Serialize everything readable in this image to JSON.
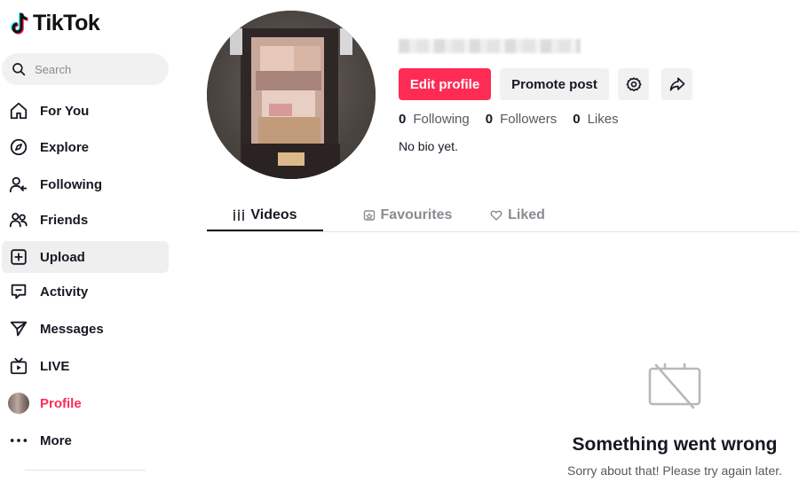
{
  "app": {
    "name": "TikTok"
  },
  "search": {
    "placeholder": "Search"
  },
  "nav": [
    {
      "key": "for-you",
      "label": "For You",
      "icon": "home-icon"
    },
    {
      "key": "explore",
      "label": "Explore",
      "icon": "compass-icon"
    },
    {
      "key": "following",
      "label": "Following",
      "icon": "user-follow-icon"
    },
    {
      "key": "friends",
      "label": "Friends",
      "icon": "friends-icon"
    },
    {
      "key": "upload",
      "label": "Upload",
      "icon": "plus-square-icon"
    },
    {
      "key": "activity",
      "label": "Activity",
      "icon": "message-square-icon"
    },
    {
      "key": "messages",
      "label": "Messages",
      "icon": "send-icon"
    },
    {
      "key": "live",
      "label": "LIVE",
      "icon": "tv-icon"
    },
    {
      "key": "profile",
      "label": "Profile",
      "icon": "avatar"
    },
    {
      "key": "more",
      "label": "More",
      "icon": "ellipsis-icon"
    }
  ],
  "profile": {
    "buttons": {
      "edit": "Edit profile",
      "promote": "Promote post"
    },
    "stats": [
      {
        "value": "0",
        "label": "Following"
      },
      {
        "value": "0",
        "label": "Followers"
      },
      {
        "value": "0",
        "label": "Likes"
      }
    ],
    "bio": "No bio yet."
  },
  "tabs": [
    {
      "label": "Videos",
      "icon": "grid-icon",
      "active": true
    },
    {
      "label": "Favourites",
      "icon": "bookmark-icon",
      "active": false
    },
    {
      "label": "Liked",
      "icon": "heart-icon",
      "active": false
    }
  ],
  "error": {
    "title": "Something went wrong",
    "message": "Sorry about that! Please try again later."
  },
  "colors": {
    "accent": "#fe2c55",
    "text": "#161823",
    "muted": "#8a8b91",
    "surface": "#f1f1f2"
  }
}
